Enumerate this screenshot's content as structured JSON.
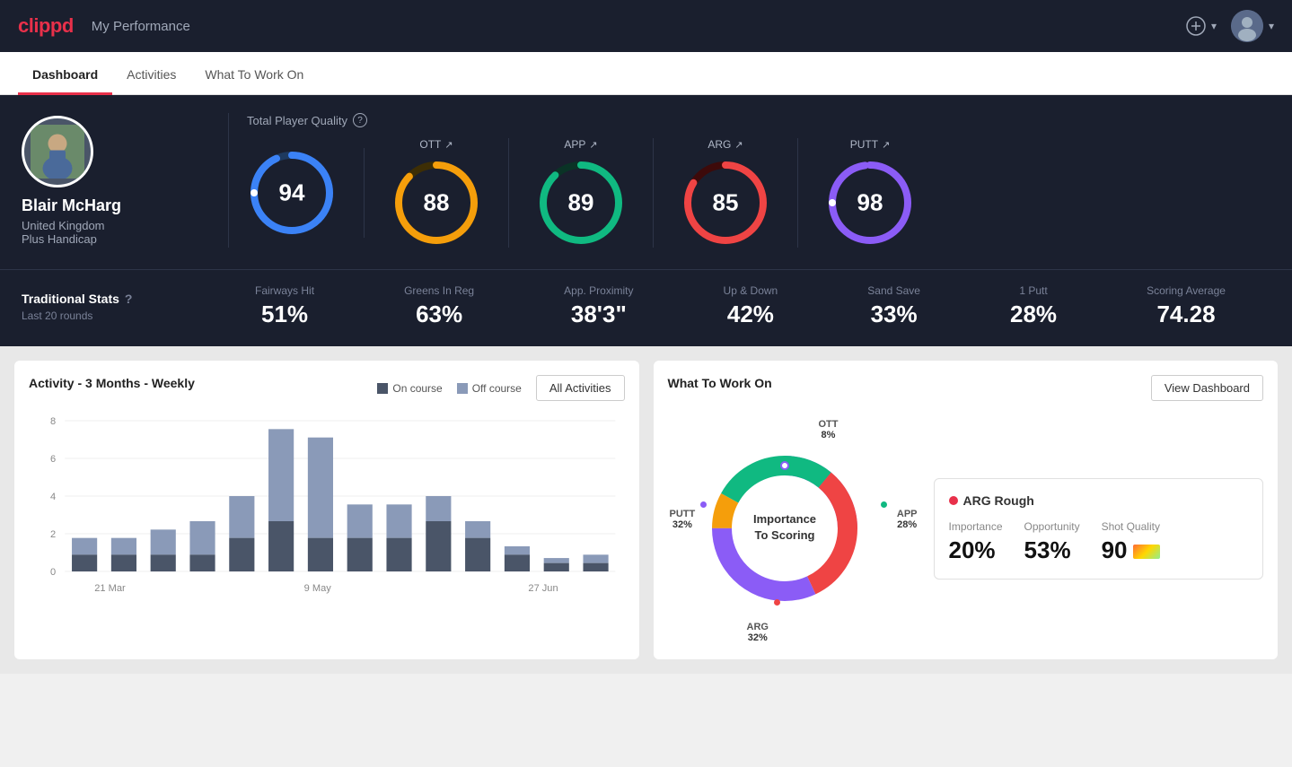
{
  "app": {
    "logo": "clippd",
    "nav_title": "My Performance"
  },
  "tabs": [
    {
      "id": "dashboard",
      "label": "Dashboard",
      "active": true
    },
    {
      "id": "activities",
      "label": "Activities",
      "active": false
    },
    {
      "id": "what_to_work_on",
      "label": "What To Work On",
      "active": false
    }
  ],
  "player": {
    "name": "Blair McHarg",
    "country": "United Kingdom",
    "handicap": "Plus Handicap"
  },
  "quality": {
    "title": "Total Player Quality",
    "main": {
      "value": "94",
      "color": "#3b82f6",
      "track": "#1e3a5f"
    },
    "ott": {
      "label": "OTT",
      "value": "88",
      "color": "#f59e0b",
      "track": "#3d2e05"
    },
    "app": {
      "label": "APP",
      "value": "89",
      "color": "#10b981",
      "track": "#0a3326"
    },
    "arg": {
      "label": "ARG",
      "value": "85",
      "color": "#ef4444",
      "track": "#3d0a0a"
    },
    "putt": {
      "label": "PUTT",
      "value": "98",
      "color": "#8b5cf6",
      "track": "#2d1a4a"
    }
  },
  "traditional_stats": {
    "title": "Traditional Stats",
    "subtitle": "Last 20 rounds",
    "stats": [
      {
        "label": "Fairways Hit",
        "value": "51%"
      },
      {
        "label": "Greens In Reg",
        "value": "63%"
      },
      {
        "label": "App. Proximity",
        "value": "38'3\""
      },
      {
        "label": "Up & Down",
        "value": "42%"
      },
      {
        "label": "Sand Save",
        "value": "33%"
      },
      {
        "label": "1 Putt",
        "value": "28%"
      },
      {
        "label": "Scoring Average",
        "value": "74.28"
      }
    ]
  },
  "activity_chart": {
    "title": "Activity - 3 Months - Weekly",
    "legend_on_course": "On course",
    "legend_off_course": "Off course",
    "all_activities_label": "All Activities",
    "x_labels": [
      "21 Mar",
      "9 May",
      "27 Jun"
    ],
    "bars": [
      {
        "on": 1,
        "off": 1
      },
      {
        "on": 1,
        "off": 1
      },
      {
        "on": 1,
        "off": 1.5
      },
      {
        "on": 1,
        "off": 2
      },
      {
        "on": 2,
        "off": 2.5
      },
      {
        "on": 3,
        "off": 5.5
      },
      {
        "on": 2,
        "off": 6
      },
      {
        "on": 2,
        "off": 2
      },
      {
        "on": 2,
        "off": 2
      },
      {
        "on": 3,
        "off": 1.5
      },
      {
        "on": 2,
        "off": 1
      },
      {
        "on": 1,
        "off": 0.5
      },
      {
        "on": 0.5,
        "off": 0.3
      },
      {
        "on": 0.5,
        "off": 0.5
      }
    ],
    "y_labels": [
      "0",
      "2",
      "4",
      "6",
      "8"
    ]
  },
  "what_to_work_on": {
    "title": "What To Work On",
    "view_dashboard_label": "View Dashboard",
    "donut": {
      "center_line1": "Importance",
      "center_line2": "To Scoring",
      "segments": [
        {
          "label": "OTT",
          "percent": "8%",
          "value": 8,
          "color": "#f59e0b"
        },
        {
          "label": "APP",
          "percent": "28%",
          "value": 28,
          "color": "#10b981"
        },
        {
          "label": "ARG",
          "percent": "32%",
          "value": 32,
          "color": "#ef4444"
        },
        {
          "label": "PUTT",
          "percent": "32%",
          "value": 32,
          "color": "#8b5cf6"
        }
      ]
    },
    "highlight_card": {
      "title": "ARG Rough",
      "dot_color": "#ef4444",
      "stats": [
        {
          "label": "Importance",
          "value": "20%"
        },
        {
          "label": "Opportunity",
          "value": "53%"
        },
        {
          "label": "Shot Quality",
          "value": "90",
          "has_bar": true
        }
      ]
    }
  }
}
